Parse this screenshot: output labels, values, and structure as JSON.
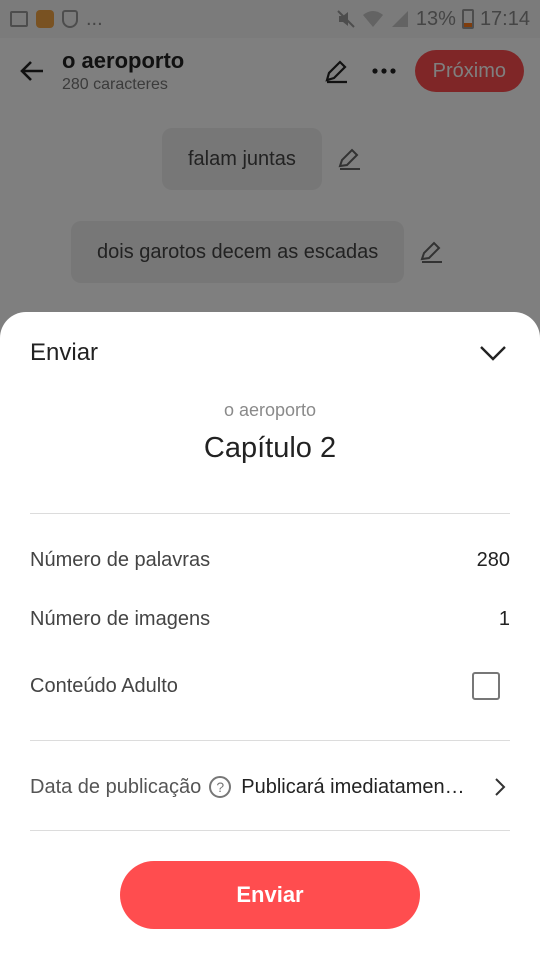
{
  "status_bar": {
    "battery": "13%",
    "time": "17:14",
    "more": "..."
  },
  "app_bar": {
    "title": "o aeroporto",
    "subtitle": "280 caracteres",
    "next_label": "Próximo"
  },
  "editor": {
    "paragraphs": [
      {
        "text": "falam juntas"
      },
      {
        "text": "dois garotos decem as escadas"
      }
    ]
  },
  "sheet": {
    "title": "Enviar",
    "story_name": "o aeroporto",
    "chapter_name": "Capítulo 2",
    "word_count_label": "Número de palavras",
    "word_count_value": "280",
    "image_count_label": "Número de imagens",
    "image_count_value": "1",
    "adult_label": "Conteúdo Adulto",
    "publish_label": "Data de publicação",
    "publish_value": "Publicará imediatamen…",
    "send_label": "Enviar"
  },
  "colors": {
    "accent": "#ff4d4f"
  }
}
